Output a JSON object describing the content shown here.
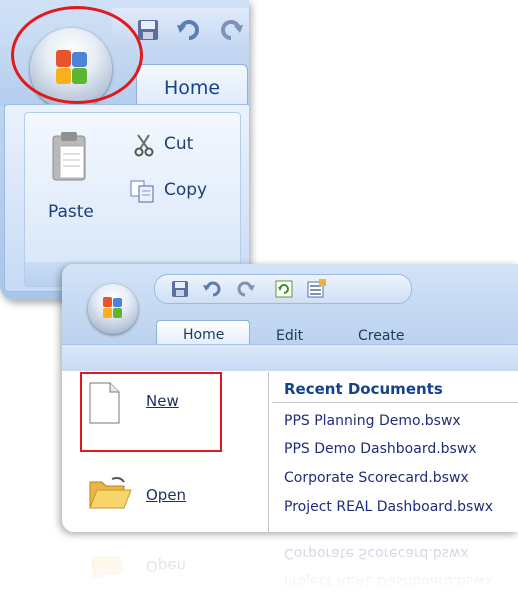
{
  "top_panel": {
    "tab_home": "Home",
    "buttons": {
      "paste": "Paste",
      "cut": "Cut",
      "copy": "Copy"
    }
  },
  "bottom_panel": {
    "tabs": [
      "Home",
      "Edit",
      "Create"
    ],
    "menu": {
      "new": "New",
      "open": "Open"
    },
    "recent": {
      "header": "Recent Documents",
      "items": [
        "PPS Planning Demo.bswx",
        "PPS Demo Dashboard.bswx",
        "Corporate Scorecard.bswx",
        "Project REAL Dashboard.bswx"
      ]
    }
  },
  "reflection": {
    "menu_open": "Open",
    "items": [
      "Corporate Scorecard.bswx",
      "Project REAL Dashboard.bswx"
    ]
  },
  "colors": {
    "highlight": "#e01a1a",
    "ribbon_blue": "#c6dbf5",
    "link": "#1f2c7a",
    "header": "#15428b"
  },
  "icons": [
    "office-button-icon",
    "save-icon",
    "undo-icon",
    "redo-icon",
    "paste-icon",
    "cut-icon",
    "copy-icon",
    "refresh-icon",
    "properties-icon",
    "new-document-icon",
    "open-folder-icon"
  ]
}
